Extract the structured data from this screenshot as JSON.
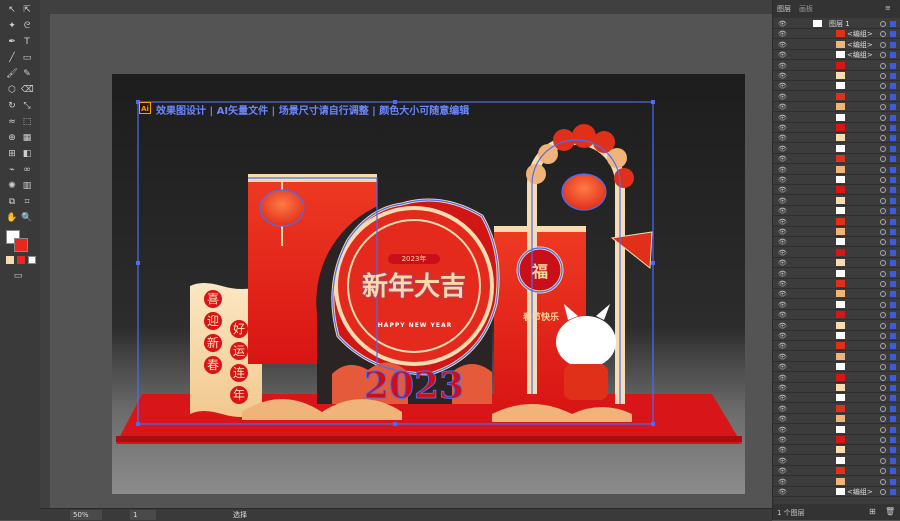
{
  "layers_panel": {
    "tabs": [
      "图层",
      "画板"
    ],
    "top_layer": "图层 1",
    "group_label": "<编组>",
    "footer_count": "1 个图层"
  },
  "artwork": {
    "header_line": "效果图设计 | AI矢量文件 | 场景尺寸请自行调整 | 颜色大小可随意编辑",
    "ai_badge": "Ai",
    "main_title": "新年大吉",
    "subtitle_small": "2023年",
    "happy_new_year": "HAPPY NEW YEAR",
    "year": "2023",
    "fu": "福",
    "left_column_1": [
      "喜",
      "迎",
      "新",
      "春"
    ],
    "left_column_2": [
      "好",
      "运",
      "连",
      "年"
    ],
    "right_panel_text": "春节快乐"
  },
  "status": {
    "zoom": "50%",
    "artboard": "1",
    "tool": "选择"
  },
  "colors": {
    "accent_red": "#e8281e",
    "selection_blue": "#4a6cf7",
    "cream": "#f6dcb0"
  }
}
